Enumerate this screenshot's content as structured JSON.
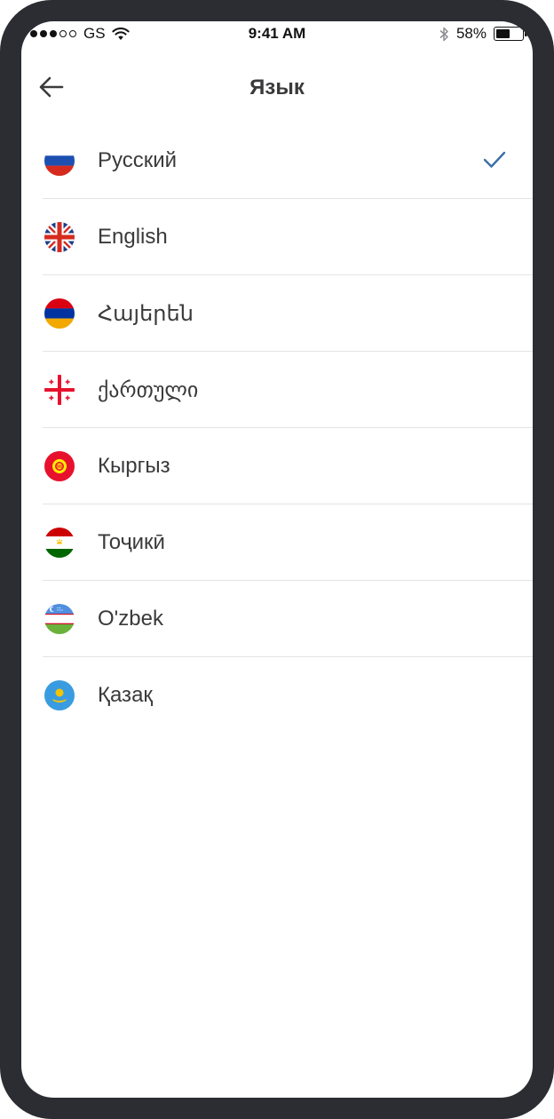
{
  "status_bar": {
    "carrier": "GS",
    "time": "9:41 AM",
    "battery_percent": "58%",
    "battery_level": 0.58
  },
  "header": {
    "title": "Язык"
  },
  "languages": [
    {
      "label": "Русский",
      "flag": "russia-flag-icon",
      "selected": true
    },
    {
      "label": "English",
      "flag": "uk-flag-icon",
      "selected": false
    },
    {
      "label": "Հայերեն",
      "flag": "armenia-flag-icon",
      "selected": false
    },
    {
      "label": "ქართული",
      "flag": "georgia-flag-icon",
      "selected": false
    },
    {
      "label": "Кыргыз",
      "flag": "kyrgyzstan-flag-icon",
      "selected": false
    },
    {
      "label": "Тоҷикӣ",
      "flag": "tajikistan-flag-icon",
      "selected": false
    },
    {
      "label": "O'zbek",
      "flag": "uzbekistan-flag-icon",
      "selected": false
    },
    {
      "label": "Қазақ",
      "flag": "kazakhstan-flag-icon",
      "selected": false
    }
  ],
  "colors": {
    "device_frame": "#2b2d33",
    "text": "#3a3a3c",
    "check": "#3d6fa8",
    "divider": "#e3e3e5"
  }
}
